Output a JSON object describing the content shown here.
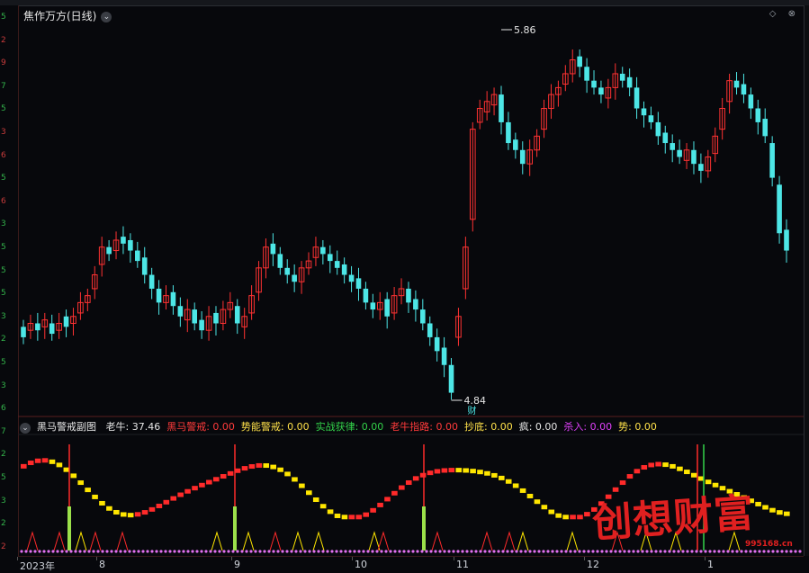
{
  "main": {
    "title": "焦作万方(日线)",
    "title_chevron": "⌄",
    "high_label": "5.86",
    "low_label": "4.84",
    "low_marker": "财",
    "window_icons": "◇ ⊗"
  },
  "left_axis_ticks": [
    {
      "text": "5",
      "color": "green"
    },
    {
      "text": "2",
      "color": "red"
    },
    {
      "text": "9",
      "color": "red"
    },
    {
      "text": "7",
      "color": "green"
    },
    {
      "text": "5",
      "color": "green"
    },
    {
      "text": "3",
      "color": "red"
    },
    {
      "text": "6",
      "color": "red"
    },
    {
      "text": "5",
      "color": "green"
    },
    {
      "text": "6",
      "color": "red"
    },
    {
      "text": "3",
      "color": "green"
    },
    {
      "text": "5",
      "color": "green"
    },
    {
      "text": "5",
      "color": "green"
    },
    {
      "text": "5",
      "color": "green"
    },
    {
      "text": "3",
      "color": "green"
    },
    {
      "text": "2",
      "color": "green"
    },
    {
      "text": "5",
      "color": "green"
    },
    {
      "text": "3",
      "color": "green"
    },
    {
      "text": "6",
      "color": "green"
    },
    {
      "text": "7",
      "color": "green"
    },
    {
      "text": "2",
      "color": "green"
    },
    {
      "text": "5",
      "color": "green"
    },
    {
      "text": "3",
      "color": "green"
    },
    {
      "text": "2",
      "color": "green"
    },
    {
      "text": "2",
      "color": "red"
    }
  ],
  "sub": {
    "chevron": "⌄",
    "name": "黑马警戒副图",
    "items": [
      {
        "label": "老牛:",
        "value": "37.46",
        "color": "#e6e6e6"
      },
      {
        "label": "黑马警戒:",
        "value": "0.00",
        "color": "#ff3b3b"
      },
      {
        "label": "势能警戒:",
        "value": "0.00",
        "color": "#ffe14a"
      },
      {
        "label": "实战获律:",
        "value": "0.00",
        "color": "#33d24a"
      },
      {
        "label": "老牛指路:",
        "value": "0.00",
        "color": "#ff3b3b"
      },
      {
        "label": "抄底:",
        "value": "0.00",
        "color": "#ffe14a"
      },
      {
        "label": "疯:",
        "value": "0.00",
        "color": "#e6e6e6"
      },
      {
        "label": "杀入:",
        "value": "0.00",
        "color": "#e040fb"
      },
      {
        "label": "势:",
        "value": "0.00",
        "color": "#ffe14a"
      }
    ]
  },
  "xaxis": {
    "labels": [
      "2023年",
      "8",
      "9",
      "10",
      "11",
      "12",
      "1"
    ]
  },
  "watermark": {
    "text": "创想财富",
    "url": "995168.cn"
  },
  "colors": {
    "up": "#ff3232",
    "down": "#4de6e6",
    "background": "#07080c"
  },
  "chart_data": {
    "type": "candlestick",
    "title": "焦作万方(日线)",
    "annotations": [
      {
        "label": "5.86",
        "type": "high"
      },
      {
        "label": "4.84",
        "type": "low"
      }
    ],
    "x_month_labels": [
      "2023年",
      "8",
      "9",
      "10",
      "11",
      "12",
      "1"
    ],
    "close": [
      5.0,
      5.04,
      5.02,
      5.05,
      5.01,
      5.04,
      5.03,
      5.06,
      5.1,
      5.12,
      5.18,
      5.26,
      5.24,
      5.28,
      5.27,
      5.25,
      5.22,
      5.18,
      5.14,
      5.1,
      5.12,
      5.09,
      5.06,
      5.08,
      5.04,
      5.02,
      5.06,
      5.04,
      5.08,
      5.1,
      5.04,
      5.06,
      5.12,
      5.2,
      5.26,
      5.24,
      5.2,
      5.18,
      5.16,
      5.2,
      5.22,
      5.26,
      5.24,
      5.22,
      5.2,
      5.18,
      5.16,
      5.14,
      5.1,
      5.08,
      5.1,
      5.06,
      5.12,
      5.14,
      5.1,
      5.08,
      5.04,
      5.0,
      4.96,
      4.92,
      4.84,
      5.06,
      5.26,
      5.6,
      5.66,
      5.68,
      5.7,
      5.62,
      5.56,
      5.54,
      5.5,
      5.54,
      5.58,
      5.66,
      5.7,
      5.72,
      5.76,
      5.8,
      5.78,
      5.74,
      5.72,
      5.7,
      5.72,
      5.76,
      5.74,
      5.72,
      5.66,
      5.64,
      5.62,
      5.58,
      5.56,
      5.54,
      5.52,
      5.54,
      5.5,
      5.48,
      5.52,
      5.58,
      5.66,
      5.74,
      5.72,
      5.7,
      5.66,
      5.62,
      5.58,
      5.46,
      5.3,
      5.25
    ],
    "open_offsets": [
      0.03,
      -0.02,
      0.02,
      -0.02,
      0.03,
      -0.02,
      0.03,
      -0.02,
      -0.03,
      -0.02,
      -0.04,
      -0.05,
      0.02,
      -0.03,
      0.02,
      0.03,
      0.03,
      0.05,
      0.04,
      0.04,
      -0.02,
      0.04,
      0.03,
      -0.03,
      0.04,
      0.03,
      -0.04,
      0.03,
      -0.04,
      -0.02,
      0.05,
      -0.03,
      -0.05,
      -0.07,
      -0.06,
      0.03,
      0.04,
      0.02,
      0.02,
      -0.04,
      -0.02,
      -0.03,
      0.02,
      0.02,
      0.02,
      0.03,
      0.02,
      0.03,
      0.04,
      0.02,
      -0.02,
      0.05,
      -0.05,
      -0.02,
      0.04,
      0.03,
      0.04,
      0.04,
      0.04,
      0.05,
      0.08,
      -0.06,
      -0.12,
      -0.26,
      -0.04,
      -0.03,
      -0.03,
      0.08,
      0.06,
      0.03,
      0.04,
      -0.04,
      -0.04,
      -0.06,
      -0.04,
      -0.02,
      -0.03,
      -0.04,
      0.03,
      0.04,
      0.02,
      0.02,
      -0.03,
      -0.04,
      0.02,
      0.03,
      0.06,
      0.02,
      0.02,
      0.04,
      0.03,
      0.02,
      0.02,
      -0.03,
      0.04,
      0.02,
      -0.04,
      -0.05,
      -0.06,
      -0.06,
      0.02,
      0.03,
      0.04,
      0.04,
      0.05,
      0.1,
      0.14,
      0.06
    ]
  }
}
